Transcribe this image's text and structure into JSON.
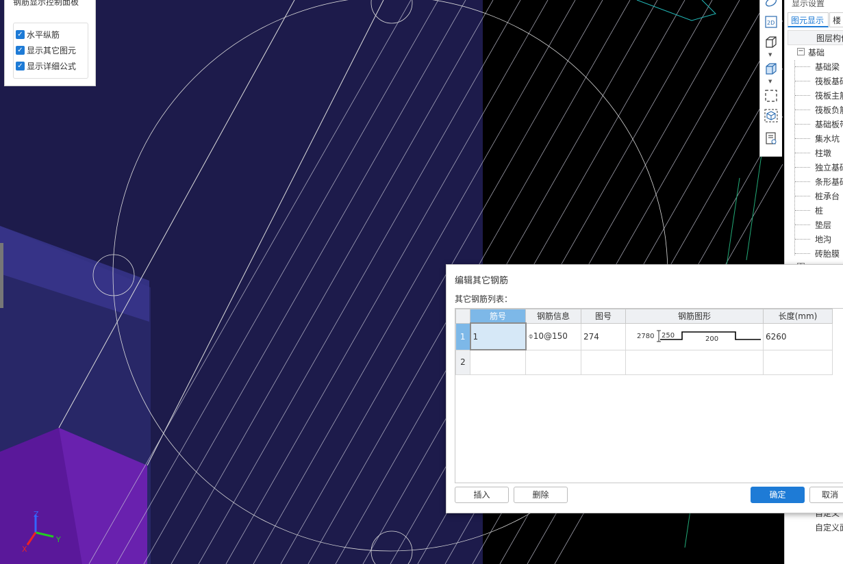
{
  "control_panel": {
    "title": "钢筋显示控制面板",
    "options": [
      {
        "label": "水平纵筋",
        "checked": true
      },
      {
        "label": "显示其它图元",
        "checked": true
      },
      {
        "label": "显示详细公式",
        "checked": true
      }
    ]
  },
  "axes": {
    "z": "Z",
    "y": "Y",
    "x": "X"
  },
  "toolbar": {
    "icons": [
      "ellipse-icon",
      "2d-view-icon",
      "box-view-icon",
      "box-filled-icon",
      "selection-frame-icon",
      "cube-view-icon",
      "document-view-icon"
    ],
    "view_2d_label": "2D"
  },
  "right_panel": {
    "title": "显示设置",
    "tabs": [
      "图元显示",
      "楼"
    ],
    "header": "图层构件",
    "group": "基础",
    "items": [
      "基础梁",
      "筏板基础",
      "筏板主筋",
      "筏板负筋",
      "基础板带",
      "集水坑",
      "柱墩",
      "独立基础",
      "条形基础",
      "桩承台",
      "桩",
      "垫层",
      "地沟",
      "砖胎膜"
    ],
    "bottom_items": [
      "自定义",
      "自定义面"
    ]
  },
  "dialog": {
    "title": "编辑其它钢筋",
    "list_label": "其它钢筋列表：",
    "columns": [
      "筋号",
      "钢筋信息",
      "图号",
      "钢筋图形",
      "长度(mm)"
    ],
    "rows": [
      {
        "num": "1",
        "bar_no": "1",
        "rebar_info": "⌽10@150",
        "figure_no": "274",
        "length": "6260",
        "shape": {
          "left_len": "2780",
          "hook": "250",
          "mid": "200"
        }
      },
      {
        "num": "2",
        "bar_no": "",
        "rebar_info": "",
        "figure_no": "",
        "length": "",
        "shape": null
      }
    ],
    "buttons": {
      "insert": "插入",
      "delete": "删除",
      "ok": "确定",
      "cancel": "取消"
    }
  },
  "colors": {
    "accent": "#1e7bd6",
    "scene_bg": "#000000",
    "slab": "#1d1b4b",
    "wall_purple": "#5a189a"
  }
}
